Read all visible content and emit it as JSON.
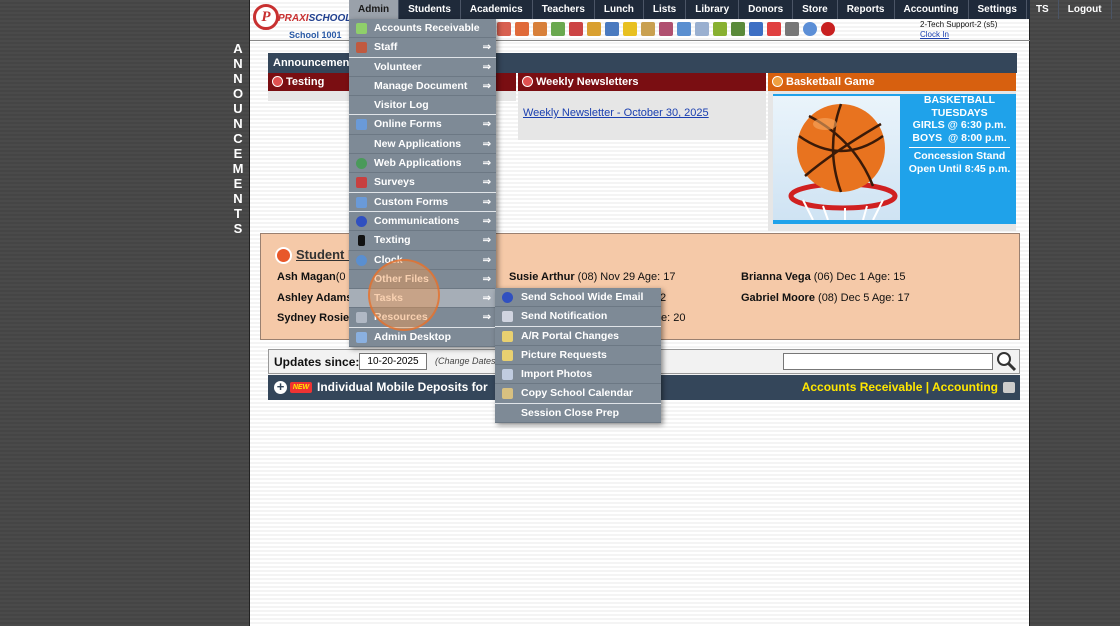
{
  "header": {
    "logo_letter": "P",
    "brand_prefix": "PRAXI",
    "brand_suffix": "SCHOOL",
    "school_name": "School 1001",
    "user_line": "2-Tech Support-2 (s5)",
    "clock_in": "Clock In"
  },
  "nav": {
    "items": [
      "Admin",
      "Students",
      "Academics",
      "Teachers",
      "Lunch",
      "Lists",
      "Library",
      "Donors",
      "Store",
      "Reports",
      "Accounting",
      "Settings",
      "TS",
      "Logout"
    ],
    "active": "Admin"
  },
  "vertical_label": [
    "A",
    "N",
    "N",
    "O",
    "U",
    "N",
    "C",
    "E",
    "M",
    "E",
    "N",
    "T",
    "S"
  ],
  "announcements": {
    "bar_title": "Announcements",
    "testing_title": "Testing",
    "newsletters_title": "Weekly Newsletters",
    "newsletter_link": "Weekly Newsletter - October 30, 2025",
    "basketball_title": "Basketball Game",
    "basketball_text": {
      "line1": "BASKETBALL",
      "line2": "TUESDAYS",
      "line3": "GIRLS @ 6:30 p.m.",
      "line4": "BOYS  @ 8:00 p.m.",
      "line5": "Concession Stand",
      "line6": "Open Until 8:45 p.m."
    }
  },
  "birthdays": {
    "title": "Student B",
    "entries": [
      {
        "name": "Ash Magan",
        "rest": "(0"
      },
      {
        "name": "Ashley Adams",
        "rest": ""
      },
      {
        "name": "Sydney Rosier",
        "rest": ""
      },
      {
        "name": "Susie Arthur",
        "rest": " (08) Nov 29 Age: 17"
      },
      {
        "name": "",
        "rest": "2"
      },
      {
        "name": "",
        "rest": "e: 20"
      },
      {
        "name": "Brianna Vega",
        "rest": " (06) Dec 1 Age: 15"
      },
      {
        "name": "Gabriel Moore",
        "rest": " (08) Dec 5 Age: 17"
      }
    ]
  },
  "updates": {
    "label": "Updates since:",
    "date_value": "10-20-2025",
    "hint": "(Change Dates",
    "search_value": ""
  },
  "deposits": {
    "new_badge": "NEW",
    "title": "Individual Mobile Deposits for",
    "link_ar": "Accounts Receivable",
    "separator": "|",
    "link_accounting": "Accounting"
  },
  "admin_menu": [
    {
      "label": "Accounts Receivable",
      "icon": "money-icon",
      "arrow": false
    },
    {
      "label": "Staff",
      "icon": "staff-icon",
      "arrow": true
    },
    {
      "label": "Volunteer",
      "icon": "",
      "arrow": true
    },
    {
      "label": "Manage Document",
      "icon": "",
      "arrow": true
    },
    {
      "label": "Visitor Log",
      "icon": "",
      "arrow": false
    },
    {
      "label": "Online Forms",
      "icon": "forms-icon",
      "arrow": true
    },
    {
      "label": "New Applications",
      "icon": "",
      "arrow": true
    },
    {
      "label": "Web Applications",
      "icon": "globe-icon",
      "arrow": true
    },
    {
      "label": "Surveys",
      "icon": "survey-icon",
      "arrow": true
    },
    {
      "label": "Custom Forms",
      "icon": "forms-icon",
      "arrow": true
    },
    {
      "label": "Communications",
      "icon": "at-icon",
      "arrow": true
    },
    {
      "label": "Texting",
      "icon": "phone-icon",
      "arrow": true
    },
    {
      "label": "Clock",
      "icon": "clock-icon",
      "arrow": true
    },
    {
      "label": "Other Files",
      "icon": "",
      "arrow": true
    },
    {
      "label": "Tasks",
      "icon": "",
      "arrow": true
    },
    {
      "label": "Resources",
      "icon": "resources-icon",
      "arrow": true
    },
    {
      "label": "Admin Desktop",
      "icon": "desktop-icon",
      "arrow": false
    }
  ],
  "tasks_menu": [
    {
      "label": "Send School Wide Email",
      "icon": "at-icon"
    },
    {
      "label": "Send Notification",
      "icon": "notification-icon"
    },
    {
      "label": "A/R Portal Changes",
      "icon": "portal-icon"
    },
    {
      "label": "Picture Requests",
      "icon": "picture-icon"
    },
    {
      "label": "Import Photos",
      "icon": "import-icon"
    },
    {
      "label": "Copy School Calendar",
      "icon": "calendar-icon"
    },
    {
      "label": "Session Close Prep",
      "icon": ""
    }
  ],
  "arrow_glyph": "⇒",
  "colors": {
    "nav_bg": "#1f2a3a",
    "menu_bg": "#7e8a96",
    "announce_red": "#7a0e12",
    "announce_orange": "#d7600f",
    "birthday_bg": "#f5c9a8",
    "link_yellow": "#ffe600"
  }
}
